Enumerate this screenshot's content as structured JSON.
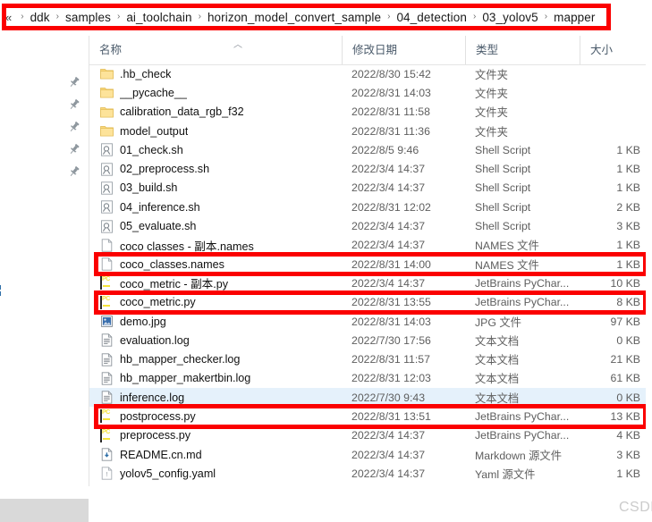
{
  "window": {
    "type": "file-explorer",
    "locale": "zh-CN"
  },
  "address_bar": {
    "overflow_indicator": "«",
    "separator": "›",
    "breadcrumbs": [
      "ddk",
      "samples",
      "ai_toolchain",
      "horizon_model_convert_sample",
      "04_detection",
      "03_yolov5",
      "mapper"
    ]
  },
  "sidebar": {
    "pin_icon": "pin-icon",
    "pinned_count": 5
  },
  "file_list": {
    "columns": [
      {
        "key": "name",
        "label": "名称"
      },
      {
        "key": "date",
        "label": "修改日期"
      },
      {
        "key": "type",
        "label": "类型"
      },
      {
        "key": "size",
        "label": "大小"
      }
    ],
    "sort": {
      "column": "名称",
      "direction": "asc",
      "caret": "︿"
    },
    "rows": [
      {
        "name": ".hb_check",
        "date": "2022/8/30 15:42",
        "type": "文件夹",
        "size": "",
        "icon": "folder-icon",
        "selected": false,
        "highlighted": false
      },
      {
        "name": "__pycache__",
        "date": "2022/8/31 14:03",
        "type": "文件夹",
        "size": "",
        "icon": "folder-icon",
        "selected": false,
        "highlighted": false
      },
      {
        "name": "calibration_data_rgb_f32",
        "date": "2022/8/31 11:58",
        "type": "文件夹",
        "size": "",
        "icon": "folder-icon",
        "selected": false,
        "highlighted": false
      },
      {
        "name": "model_output",
        "date": "2022/8/31 11:36",
        "type": "文件夹",
        "size": "",
        "icon": "folder-icon",
        "selected": false,
        "highlighted": false
      },
      {
        "name": "01_check.sh",
        "date": "2022/8/5 9:46",
        "type": "Shell Script",
        "size": "1 KB",
        "icon": "shell-script-icon",
        "selected": false,
        "highlighted": false
      },
      {
        "name": "02_preprocess.sh",
        "date": "2022/3/4 14:37",
        "type": "Shell Script",
        "size": "1 KB",
        "icon": "shell-script-icon",
        "selected": false,
        "highlighted": false
      },
      {
        "name": "03_build.sh",
        "date": "2022/3/4 14:37",
        "type": "Shell Script",
        "size": "1 KB",
        "icon": "shell-script-icon",
        "selected": false,
        "highlighted": false
      },
      {
        "name": "04_inference.sh",
        "date": "2022/8/31 12:02",
        "type": "Shell Script",
        "size": "2 KB",
        "icon": "shell-script-icon",
        "selected": false,
        "highlighted": false
      },
      {
        "name": "05_evaluate.sh",
        "date": "2022/3/4 14:37",
        "type": "Shell Script",
        "size": "3 KB",
        "icon": "shell-script-icon",
        "selected": false,
        "highlighted": false
      },
      {
        "name": "coco classes - 副本.names",
        "date": "2022/3/4 14:37",
        "type": "NAMES 文件",
        "size": "1 KB",
        "icon": "generic-file-icon",
        "selected": false,
        "highlighted": false
      },
      {
        "name": "coco_classes.names",
        "date": "2022/8/31 14:00",
        "type": "NAMES 文件",
        "size": "1 KB",
        "icon": "generic-file-icon",
        "selected": false,
        "highlighted": true
      },
      {
        "name": "coco_metric - 副本.py",
        "date": "2022/3/4 14:37",
        "type": "JetBrains PyChar...",
        "size": "10 KB",
        "icon": "pycharm-icon",
        "selected": false,
        "highlighted": false
      },
      {
        "name": "coco_metric.py",
        "date": "2022/8/31 13:55",
        "type": "JetBrains PyChar...",
        "size": "8 KB",
        "icon": "pycharm-icon",
        "selected": false,
        "highlighted": true
      },
      {
        "name": "demo.jpg",
        "date": "2022/8/31 14:03",
        "type": "JPG 文件",
        "size": "97 KB",
        "icon": "image-file-icon",
        "selected": false,
        "highlighted": false
      },
      {
        "name": "evaluation.log",
        "date": "2022/7/30 17:56",
        "type": "文本文档",
        "size": "0 KB",
        "icon": "text-file-icon",
        "selected": false,
        "highlighted": false
      },
      {
        "name": "hb_mapper_checker.log",
        "date": "2022/8/31 11:57",
        "type": "文本文档",
        "size": "21 KB",
        "icon": "text-file-icon",
        "selected": false,
        "highlighted": false
      },
      {
        "name": "hb_mapper_makertbin.log",
        "date": "2022/8/31 12:03",
        "type": "文本文档",
        "size": "61 KB",
        "icon": "text-file-icon",
        "selected": false,
        "highlighted": false
      },
      {
        "name": "inference.log",
        "date": "2022/7/30 9:43",
        "type": "文本文档",
        "size": "0 KB",
        "icon": "text-file-icon",
        "selected": true,
        "highlighted": false
      },
      {
        "name": "postprocess.py",
        "date": "2022/8/31 13:51",
        "type": "JetBrains PyChar...",
        "size": "13 KB",
        "icon": "pycharm-icon",
        "selected": false,
        "highlighted": true
      },
      {
        "name": "preprocess.py",
        "date": "2022/3/4 14:37",
        "type": "JetBrains PyChar...",
        "size": "4 KB",
        "icon": "pycharm-icon",
        "selected": false,
        "highlighted": false
      },
      {
        "name": "README.cn.md",
        "date": "2022/3/4 14:37",
        "type": "Markdown 源文件",
        "size": "3 KB",
        "icon": "markdown-file-icon",
        "selected": false,
        "highlighted": false
      },
      {
        "name": "yolov5_config.yaml",
        "date": "2022/3/4 14:37",
        "type": "Yaml 源文件",
        "size": "1 KB",
        "icon": "yaml-file-icon",
        "selected": false,
        "highlighted": false
      }
    ]
  },
  "annotations": {
    "color": "#fb0000",
    "boxes": [
      {
        "target": "breadcrumb"
      },
      {
        "target": "coco_classes.names"
      },
      {
        "target": "coco_metric.py"
      },
      {
        "target": "postprocess.py"
      }
    ]
  },
  "watermark": {
    "text": "CSDN @扇贝丫K"
  }
}
